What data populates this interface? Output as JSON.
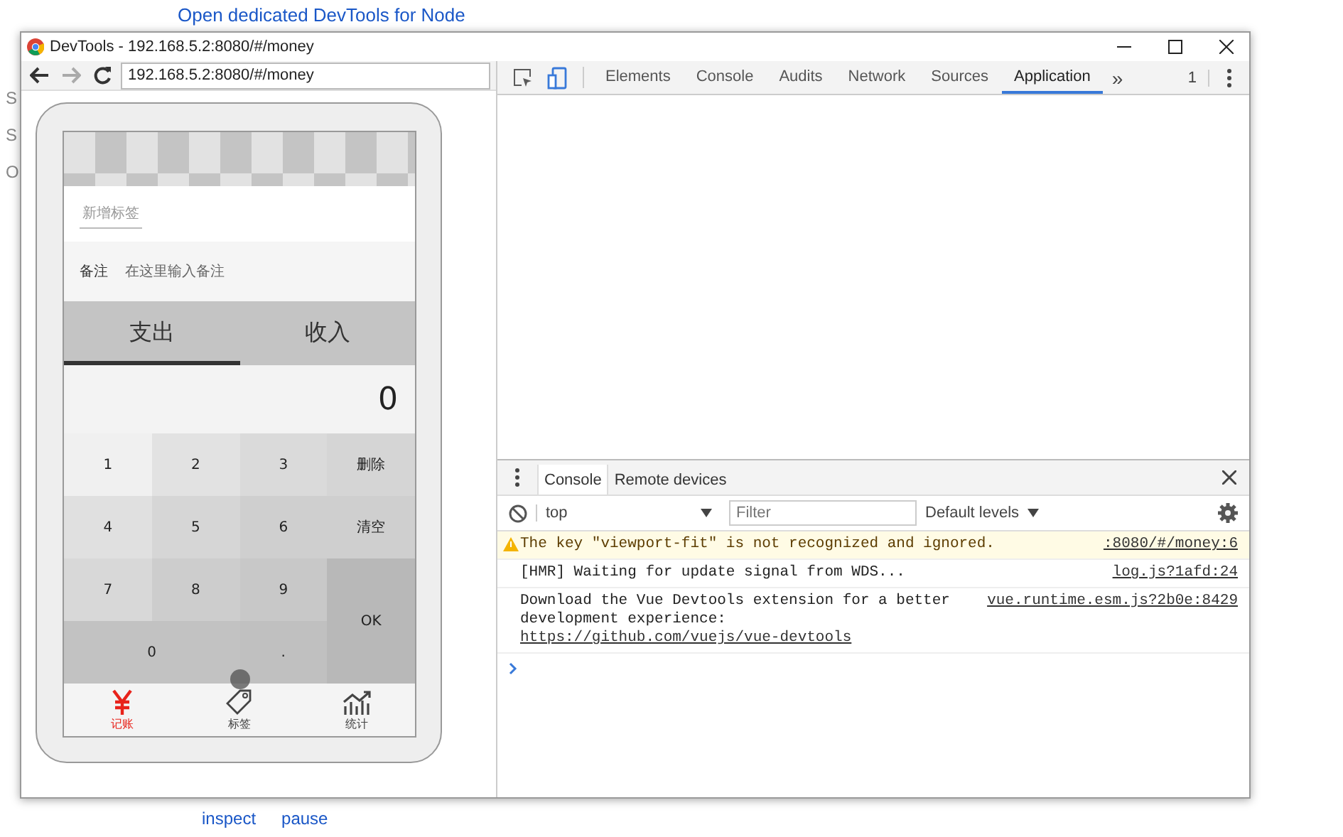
{
  "background_page": {
    "top_link": "Open dedicated DevTools for Node",
    "side_fragments": [
      "S",
      "S",
      "O"
    ],
    "bottom_links": [
      "inspect",
      "pause"
    ]
  },
  "window": {
    "title": "DevTools - 192.168.5.2:8080/#/money"
  },
  "address_bar": {
    "value": "192.168.5.2:8080/#/money"
  },
  "app": {
    "tag_button": "新增标签",
    "note": {
      "label": "备注",
      "placeholder": "在这里输入备注"
    },
    "type_tabs": [
      {
        "label": "支出",
        "selected": true
      },
      {
        "label": "收入",
        "selected": false
      }
    ],
    "amount": "0",
    "keys": [
      {
        "label": "1",
        "kind": "digit"
      },
      {
        "label": "2",
        "kind": "digit"
      },
      {
        "label": "3",
        "kind": "digit"
      },
      {
        "label": "删除",
        "kind": "digit"
      },
      {
        "label": "4",
        "kind": "digit"
      },
      {
        "label": "5",
        "kind": "digit"
      },
      {
        "label": "6",
        "kind": "digit"
      },
      {
        "label": "清空",
        "kind": "digit"
      },
      {
        "label": "7",
        "kind": "digit"
      },
      {
        "label": "8",
        "kind": "digit"
      },
      {
        "label": "9",
        "kind": "digit"
      },
      {
        "label": "OK",
        "kind": "tall"
      },
      {
        "label": "0",
        "kind": "wide"
      },
      {
        "label": ".",
        "kind": "digit"
      }
    ],
    "nav": [
      {
        "label": "记账",
        "kind": "yen",
        "selected": true
      },
      {
        "label": "标签",
        "kind": "tag",
        "selected": false
      },
      {
        "label": "统计",
        "kind": "chart",
        "selected": false
      }
    ]
  },
  "devtools": {
    "tabs": [
      {
        "label": "Elements",
        "selected": false
      },
      {
        "label": "Console",
        "selected": false
      },
      {
        "label": "Audits",
        "selected": false
      },
      {
        "label": "Network",
        "selected": false
      },
      {
        "label": "Sources",
        "selected": false
      },
      {
        "label": "Application",
        "selected": true
      }
    ],
    "overflow": "»",
    "issue_count": "1",
    "drawer": {
      "tabs": [
        {
          "label": "Console",
          "selected": true
        },
        {
          "label": "Remote devices",
          "selected": false
        }
      ],
      "context": "top",
      "filter_placeholder": "Filter",
      "levels": "Default levels",
      "messages": [
        {
          "kind": "warning",
          "text": "The key \"viewport-fit\" is not recognized and ignored.",
          "source": ":8080/#/money:6"
        },
        {
          "kind": "log",
          "text": "[HMR] Waiting for update signal from WDS...",
          "source": "log.js?1afd:24"
        },
        {
          "kind": "log",
          "text": "Download the Vue Devtools extension for a better development experience:",
          "link": "https://github.com/vuejs/vue-devtools",
          "source": "vue.runtime.esm.js?2b0e:8429"
        }
      ]
    }
  }
}
